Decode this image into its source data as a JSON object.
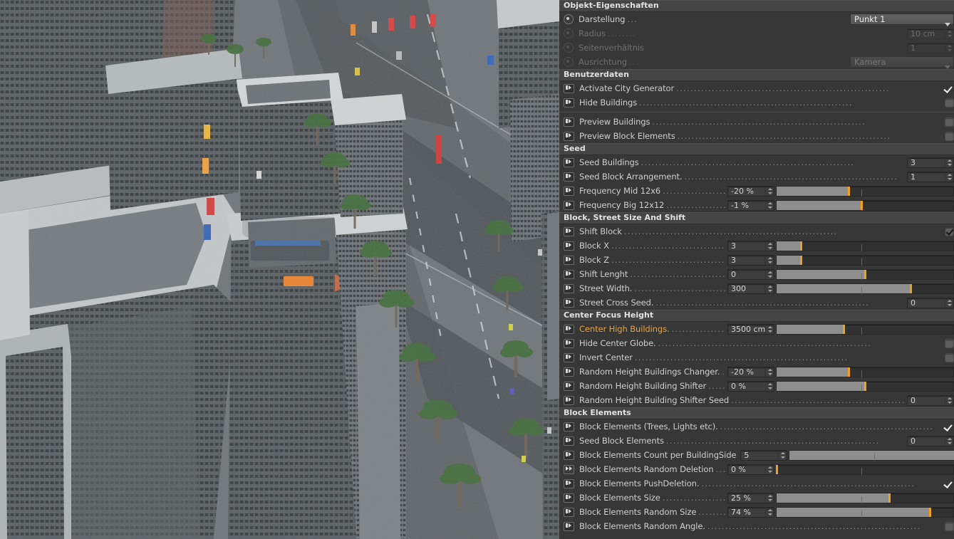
{
  "viewport": {
    "name": "3d-city-render-viewport",
    "description": "Aerial 3D render of a generated city with skyscrapers, wide streets, palm trees and long shadows",
    "sky_color": "#8a8f92",
    "street_color": "#53585c",
    "shadow_color": "#3a3f44",
    "building_face_light": "#b9bcbe",
    "building_face_dark": "#4e5357",
    "tree_color": "#3d6b34"
  },
  "panel": {
    "title": "Objekt-Eigenschaften",
    "groups": [
      {
        "id": "object-properties",
        "header": null,
        "rows": [
          {
            "gadget": "radio-on",
            "label": "Darstellung",
            "dots": "...",
            "control": "dropdown",
            "value": "Punkt 1",
            "disabled": false,
            "width": 146
          },
          {
            "gadget": "radio-off",
            "label": "Radius",
            "dots": "........",
            "control": "number",
            "value": "10 cm",
            "disabled": true
          },
          {
            "gadget": "radio-off",
            "label": "Seitenverhältnis",
            "dots": "",
            "control": "number",
            "value": "1",
            "disabled": true
          },
          {
            "gadget": "radio-off",
            "label": "Ausrichtung",
            "dots": "...",
            "control": "dropdown",
            "value": "Kamera",
            "disabled": true,
            "width": 146
          }
        ]
      },
      {
        "id": "benutzerdaten",
        "header": "Benutzerdaten",
        "rows": [
          {
            "gadget": "anim",
            "label": "Activate City Generator",
            "control": "checkbox",
            "checked": true
          },
          {
            "gadget": "anim",
            "label": "Hide Buildings",
            "control": "checkbox",
            "checked": false
          },
          {
            "separator": true
          },
          {
            "gadget": "anim",
            "label": "Preview Buildings",
            "control": "checkbox",
            "checked": false
          },
          {
            "gadget": "anim",
            "label": "Preview Block Elements",
            "control": "checkbox",
            "checked": false
          }
        ]
      },
      {
        "id": "seed",
        "header": "Seed",
        "rows": [
          {
            "gadget": "anim",
            "label": "Seed Buildings",
            "control": "number",
            "value": "3"
          },
          {
            "gadget": "anim",
            "label": "Seed Block Arrangement.",
            "control": "number",
            "value": "1"
          },
          {
            "gadget": "anim",
            "label": "Frequency Mid 12x6",
            "control": "slider",
            "value": "-20 %",
            "fill": 41,
            "tick": 48
          },
          {
            "gadget": "anim",
            "label": "Frequency Big 12x12",
            "control": "slider",
            "value": "-1 %",
            "fill": 48,
            "tick": 48
          }
        ]
      },
      {
        "id": "block-street-size-and-shift",
        "header": "Block, Street Size And Shift",
        "rows": [
          {
            "gadget": "anim",
            "label": "Shift Block",
            "control": "checkbox-boxed",
            "checked": true
          },
          {
            "gadget": "anim",
            "label": "Block X",
            "control": "slider",
            "value": "3",
            "fill": 14,
            "tick": 48
          },
          {
            "gadget": "anim",
            "label": "Block Z",
            "control": "slider",
            "value": "3",
            "fill": 14,
            "tick": 48
          },
          {
            "gadget": "anim",
            "label": "Shift Lenght",
            "control": "slider",
            "value": "0",
            "fill": 50,
            "tick": 48
          },
          {
            "gadget": "anim",
            "label": "Street Width.",
            "control": "slider",
            "value": "300",
            "fill": 76,
            "tick": 48
          },
          {
            "gadget": "anim",
            "label": "Street Cross Seed.",
            "control": "number",
            "value": "0"
          }
        ]
      },
      {
        "id": "center-focus-height",
        "header": "Center Focus Height",
        "rows": [
          {
            "gadget": "anim",
            "label": "Center High Buildings.",
            "control": "slider",
            "value": "3500 cm",
            "fill": 38,
            "tick": 48,
            "highlight": true
          },
          {
            "gadget": "anim",
            "label": "Hide Center Globe.",
            "control": "checkbox",
            "checked": false
          },
          {
            "gadget": "anim",
            "label": "Invert Center",
            "control": "checkbox",
            "checked": false
          },
          {
            "gadget": "anim",
            "label": "Random Height Buildings Changer.",
            "control": "slider",
            "value": "-20 %",
            "fill": 41,
            "tick": 48
          },
          {
            "gadget": "anim",
            "label": "Random Height Building Shifter",
            "control": "slider",
            "value": "0 %",
            "fill": 50,
            "tick": 48
          },
          {
            "gadget": "anim",
            "label": "Random Height Building Shifter Seed",
            "control": "number",
            "value": "0"
          }
        ]
      },
      {
        "id": "block-elements",
        "header": "Block Elements",
        "rows": [
          {
            "gadget": "anim",
            "label": "Block Elements (Trees, Lights etc).",
            "control": "checkbox",
            "checked": true
          },
          {
            "gadget": "anim",
            "label": "Seed Block Elements",
            "control": "number",
            "value": "0"
          },
          {
            "gadget": "anim",
            "label": "Block Elements Count per BuildingSide",
            "control": "slider",
            "value": "5",
            "fill": 97,
            "tick": 48
          },
          {
            "gadget": "keyed",
            "label": "Block Elements Random Deletion",
            "control": "slider",
            "value": "0 %",
            "fill": 0,
            "tick": 48
          },
          {
            "gadget": "anim",
            "label": "Block Elements PushDeletion.",
            "control": "checkbox",
            "checked": true
          },
          {
            "gadget": "anim",
            "label": "Block Elements Size",
            "control": "slider",
            "value": "25 %",
            "fill": 64,
            "tick": 48
          },
          {
            "gadget": "anim",
            "label": "Block Elements Random Size",
            "control": "slider",
            "value": "74 %",
            "fill": 87,
            "tick": 48
          },
          {
            "gadget": "anim",
            "label": "Block Elements Random Angle.",
            "control": "checkbox",
            "checked": false
          }
        ]
      }
    ]
  },
  "colors": {
    "panel_bg": "#373737",
    "group_header_bg": "#454545",
    "accent_orange": "#f0a020",
    "label_text": "#cfcfcf",
    "slider_fill": "#8e8e8e",
    "slider_track": "#313131"
  }
}
